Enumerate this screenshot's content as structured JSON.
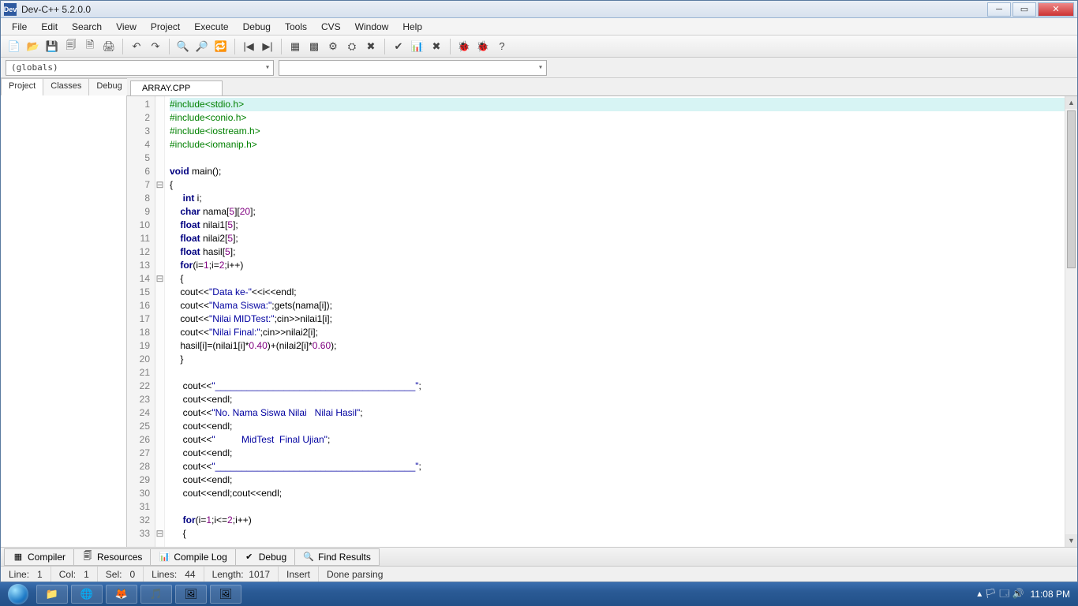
{
  "window": {
    "title": "Dev-C++ 5.2.0.0",
    "appicon": "Dev"
  },
  "menu": [
    "File",
    "Edit",
    "Search",
    "View",
    "Project",
    "Execute",
    "Debug",
    "Tools",
    "CVS",
    "Window",
    "Help"
  ],
  "toolbar_groups": [
    [
      "📄",
      "📂",
      "💾",
      "🗐",
      "🗎",
      "🖨"
    ],
    [
      "↶",
      "↷"
    ],
    [
      "🔍",
      "🔎",
      "🔁"
    ],
    [
      "|◀",
      "▶|"
    ],
    [
      "▦",
      "▩",
      "⚙",
      "⛭",
      "✖"
    ],
    [
      "✔",
      "📊",
      "✖"
    ],
    [
      "🐞",
      "🐞",
      "?"
    ]
  ],
  "combo_globals": "(globals)",
  "left_tabs": [
    "Project",
    "Classes",
    "Debug"
  ],
  "file_tab": "ARRAY.CPP",
  "code_lines": [
    {
      "n": 1,
      "fold": "",
      "active": true,
      "segs": [
        {
          "c": "tok-pre",
          "t": "#include<stdio.h>"
        }
      ]
    },
    {
      "n": 2,
      "fold": "",
      "segs": [
        {
          "c": "tok-pre",
          "t": "#include<conio.h>"
        }
      ]
    },
    {
      "n": 3,
      "fold": "",
      "segs": [
        {
          "c": "tok-pre",
          "t": "#include<iostream.h>"
        }
      ]
    },
    {
      "n": 4,
      "fold": "",
      "segs": [
        {
          "c": "tok-pre",
          "t": "#include<iomanip.h>"
        }
      ]
    },
    {
      "n": 5,
      "fold": "",
      "segs": [
        {
          "c": "",
          "t": ""
        }
      ]
    },
    {
      "n": 6,
      "fold": "",
      "segs": [
        {
          "c": "tok-kw",
          "t": "void"
        },
        {
          "c": "",
          "t": " main();"
        }
      ]
    },
    {
      "n": 7,
      "fold": "⊟",
      "segs": [
        {
          "c": "",
          "t": "{"
        }
      ]
    },
    {
      "n": 8,
      "fold": "",
      "segs": [
        {
          "c": "",
          "t": "     "
        },
        {
          "c": "tok-kw",
          "t": "int"
        },
        {
          "c": "",
          "t": " i;"
        }
      ]
    },
    {
      "n": 9,
      "fold": "",
      "segs": [
        {
          "c": "",
          "t": "    "
        },
        {
          "c": "tok-kw",
          "t": "char"
        },
        {
          "c": "",
          "t": " nama["
        },
        {
          "c": "tok-num",
          "t": "5"
        },
        {
          "c": "",
          "t": "]["
        },
        {
          "c": "tok-num",
          "t": "20"
        },
        {
          "c": "",
          "t": "];"
        }
      ]
    },
    {
      "n": 10,
      "fold": "",
      "segs": [
        {
          "c": "",
          "t": "    "
        },
        {
          "c": "tok-kw",
          "t": "float"
        },
        {
          "c": "",
          "t": " nilai1["
        },
        {
          "c": "tok-num",
          "t": "5"
        },
        {
          "c": "",
          "t": "];"
        }
      ]
    },
    {
      "n": 11,
      "fold": "",
      "segs": [
        {
          "c": "",
          "t": "    "
        },
        {
          "c": "tok-kw",
          "t": "float"
        },
        {
          "c": "",
          "t": " nilai2["
        },
        {
          "c": "tok-num",
          "t": "5"
        },
        {
          "c": "",
          "t": "];"
        }
      ]
    },
    {
      "n": 12,
      "fold": "",
      "segs": [
        {
          "c": "",
          "t": "    "
        },
        {
          "c": "tok-kw",
          "t": "float"
        },
        {
          "c": "",
          "t": " hasil["
        },
        {
          "c": "tok-num",
          "t": "5"
        },
        {
          "c": "",
          "t": "];"
        }
      ]
    },
    {
      "n": 13,
      "fold": "",
      "segs": [
        {
          "c": "",
          "t": "    "
        },
        {
          "c": "tok-kw",
          "t": "for"
        },
        {
          "c": "",
          "t": "(i="
        },
        {
          "c": "tok-num",
          "t": "1"
        },
        {
          "c": "",
          "t": ";i="
        },
        {
          "c": "tok-num",
          "t": "2"
        },
        {
          "c": "",
          "t": ";i++)"
        }
      ]
    },
    {
      "n": 14,
      "fold": "⊟",
      "segs": [
        {
          "c": "",
          "t": "    {"
        }
      ]
    },
    {
      "n": 15,
      "fold": "",
      "segs": [
        {
          "c": "",
          "t": "    cout<<"
        },
        {
          "c": "tok-str",
          "t": "\"Data ke-\""
        },
        {
          "c": "",
          "t": "<<i<<endl;"
        }
      ]
    },
    {
      "n": 16,
      "fold": "",
      "segs": [
        {
          "c": "",
          "t": "    cout<<"
        },
        {
          "c": "tok-str",
          "t": "\"Nama Siswa:\""
        },
        {
          "c": "",
          "t": ";gets(nama[i]);"
        }
      ]
    },
    {
      "n": 17,
      "fold": "",
      "segs": [
        {
          "c": "",
          "t": "    cout<<"
        },
        {
          "c": "tok-str",
          "t": "\"Nilai MIDTest:\""
        },
        {
          "c": "",
          "t": ";cin>>nilai1[i];"
        }
      ]
    },
    {
      "n": 18,
      "fold": "",
      "segs": [
        {
          "c": "",
          "t": "    cout<<"
        },
        {
          "c": "tok-str",
          "t": "\"Nilai Final:\""
        },
        {
          "c": "",
          "t": ";cin>>nilai2[i];"
        }
      ]
    },
    {
      "n": 19,
      "fold": "",
      "segs": [
        {
          "c": "",
          "t": "    hasil[i]=(nilai1[i]*"
        },
        {
          "c": "tok-num",
          "t": "0.40"
        },
        {
          "c": "",
          "t": ")+(nilai2[i]*"
        },
        {
          "c": "tok-num",
          "t": "0.60"
        },
        {
          "c": "",
          "t": ");"
        }
      ]
    },
    {
      "n": 20,
      "fold": "",
      "segs": [
        {
          "c": "",
          "t": "    }"
        }
      ]
    },
    {
      "n": 21,
      "fold": "",
      "segs": [
        {
          "c": "",
          "t": ""
        }
      ]
    },
    {
      "n": 22,
      "fold": "",
      "segs": [
        {
          "c": "",
          "t": "     cout<<"
        },
        {
          "c": "tok-str",
          "t": "\"______________________________________\""
        },
        {
          "c": "",
          "t": ";"
        }
      ]
    },
    {
      "n": 23,
      "fold": "",
      "segs": [
        {
          "c": "",
          "t": "     cout<<endl;"
        }
      ]
    },
    {
      "n": 24,
      "fold": "",
      "segs": [
        {
          "c": "",
          "t": "     cout<<"
        },
        {
          "c": "tok-str",
          "t": "\"No. Nama Siswa Nilai   Nilai Hasil\""
        },
        {
          "c": "",
          "t": ";"
        }
      ]
    },
    {
      "n": 25,
      "fold": "",
      "segs": [
        {
          "c": "",
          "t": "     cout<<endl;"
        }
      ]
    },
    {
      "n": 26,
      "fold": "",
      "segs": [
        {
          "c": "",
          "t": "     cout<<"
        },
        {
          "c": "tok-str",
          "t": "\"          MidTest  Final Ujian\""
        },
        {
          "c": "",
          "t": ";"
        }
      ]
    },
    {
      "n": 27,
      "fold": "",
      "segs": [
        {
          "c": "",
          "t": "     cout<<endl;"
        }
      ]
    },
    {
      "n": 28,
      "fold": "",
      "segs": [
        {
          "c": "",
          "t": "     cout<<"
        },
        {
          "c": "tok-str",
          "t": "\"______________________________________\""
        },
        {
          "c": "",
          "t": ";"
        }
      ]
    },
    {
      "n": 29,
      "fold": "",
      "segs": [
        {
          "c": "",
          "t": "     cout<<endl;"
        }
      ]
    },
    {
      "n": 30,
      "fold": "",
      "segs": [
        {
          "c": "",
          "t": "     cout<<endl;cout<<endl;"
        }
      ]
    },
    {
      "n": 31,
      "fold": "",
      "segs": [
        {
          "c": "",
          "t": ""
        }
      ]
    },
    {
      "n": 32,
      "fold": "",
      "segs": [
        {
          "c": "",
          "t": "     "
        },
        {
          "c": "tok-kw",
          "t": "for"
        },
        {
          "c": "",
          "t": "(i="
        },
        {
          "c": "tok-num",
          "t": "1"
        },
        {
          "c": "",
          "t": ";i<="
        },
        {
          "c": "tok-num",
          "t": "2"
        },
        {
          "c": "",
          "t": ";i++)"
        }
      ]
    },
    {
      "n": 33,
      "fold": "⊟",
      "segs": [
        {
          "c": "",
          "t": "     {"
        }
      ]
    }
  ],
  "bottom_tabs": [
    {
      "icon": "▦",
      "label": "Compiler"
    },
    {
      "icon": "🗐",
      "label": "Resources"
    },
    {
      "icon": "📊",
      "label": "Compile Log"
    },
    {
      "icon": "✔",
      "label": "Debug"
    },
    {
      "icon": "🔍",
      "label": "Find Results"
    }
  ],
  "status": {
    "line_lbl": "Line:",
    "line": "1",
    "col_lbl": "Col:",
    "col": "1",
    "sel_lbl": "Sel:",
    "sel": "0",
    "lines_lbl": "Lines:",
    "lines": "44",
    "length_lbl": "Length:",
    "length": "1017",
    "mode": "Insert",
    "parse": "Done parsing"
  },
  "taskbar": {
    "items": [
      "📁",
      "🌐",
      "🦊",
      "🎵",
      "🖼",
      "🖼"
    ],
    "tray_icons": [
      "▴",
      "🏳",
      "🗔",
      "🔊"
    ],
    "time": "11:08 PM"
  }
}
